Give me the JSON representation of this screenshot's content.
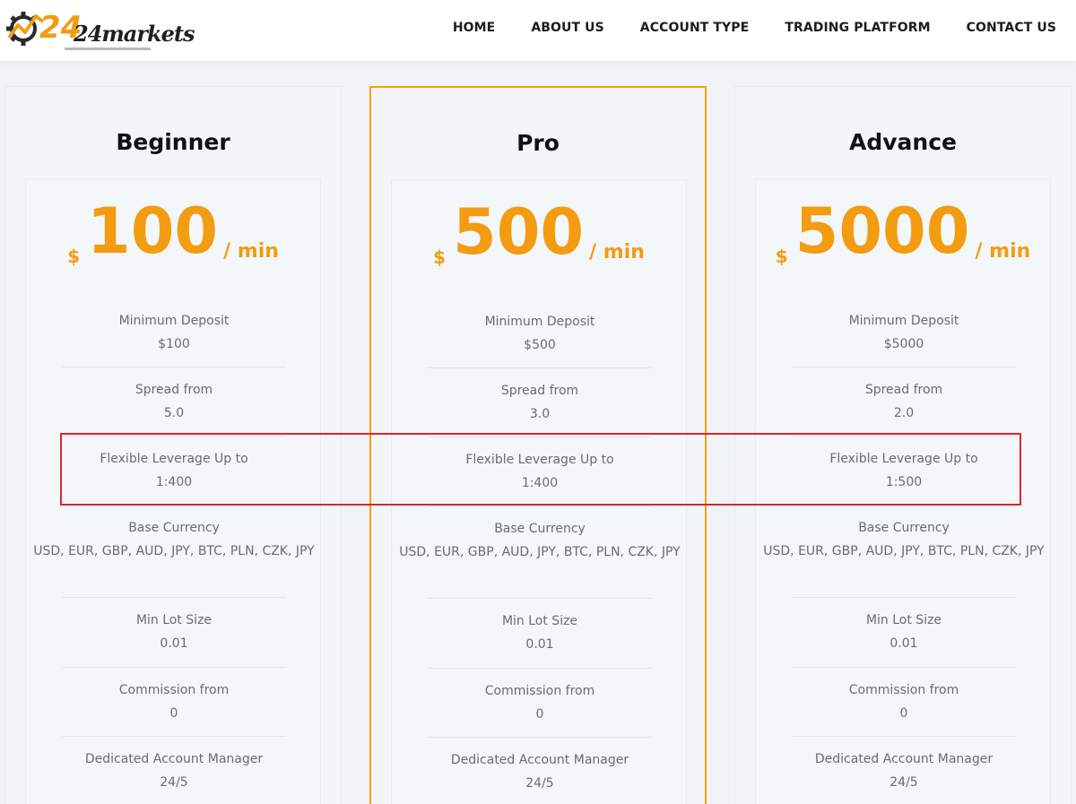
{
  "header": {
    "logo_text": "24markets",
    "nav": [
      "HOME",
      "ABOUT US",
      "ACCOUNT TYPE",
      "TRADING PLATFORM",
      "CONTACT US"
    ]
  },
  "colors": {
    "accent": "#f39c12",
    "featured_border": "#f5a20a",
    "highlight": "#e0242b"
  },
  "plans": [
    {
      "title": "Beginner",
      "currency": "$",
      "price": "100",
      "per": "/ min",
      "features": [
        {
          "label": "Minimum Deposit",
          "value": "$100"
        },
        {
          "label": "Spread from",
          "value": "5.0"
        },
        {
          "label": "Flexible Leverage Up to",
          "value": "1:400"
        },
        {
          "label": "Base Currency",
          "value": "USD, EUR, GBP, AUD, JPY, BTC, PLN, CZK, JPY"
        },
        {
          "label": "Min Lot Size",
          "value": "0.01"
        },
        {
          "label": "Commission from",
          "value": "0"
        },
        {
          "label": "Dedicated Account Manager",
          "value": "24/5"
        }
      ]
    },
    {
      "title": "Pro",
      "currency": "$",
      "price": "500",
      "per": "/ min",
      "features": [
        {
          "label": "Minimum Deposit",
          "value": "$500"
        },
        {
          "label": "Spread from",
          "value": "3.0"
        },
        {
          "label": "Flexible Leverage Up to",
          "value": "1:400"
        },
        {
          "label": "Base Currency",
          "value": "USD, EUR, GBP, AUD, JPY, BTC, PLN, CZK, JPY"
        },
        {
          "label": "Min Lot Size",
          "value": "0.01"
        },
        {
          "label": "Commission from",
          "value": "0"
        },
        {
          "label": "Dedicated Account Manager",
          "value": "24/5"
        }
      ]
    },
    {
      "title": "Advance",
      "currency": "$",
      "price": "5000",
      "per": "/ min",
      "features": [
        {
          "label": "Minimum Deposit",
          "value": "$5000"
        },
        {
          "label": "Spread from",
          "value": "2.0"
        },
        {
          "label": "Flexible Leverage Up to",
          "value": "1:500"
        },
        {
          "label": "Base Currency",
          "value": "USD, EUR, GBP, AUD, JPY, BTC, PLN, CZK, JPY"
        },
        {
          "label": "Min Lot Size",
          "value": "0.01"
        },
        {
          "label": "Commission from",
          "value": "0"
        },
        {
          "label": "Dedicated Account Manager",
          "value": "24/5"
        }
      ]
    }
  ]
}
